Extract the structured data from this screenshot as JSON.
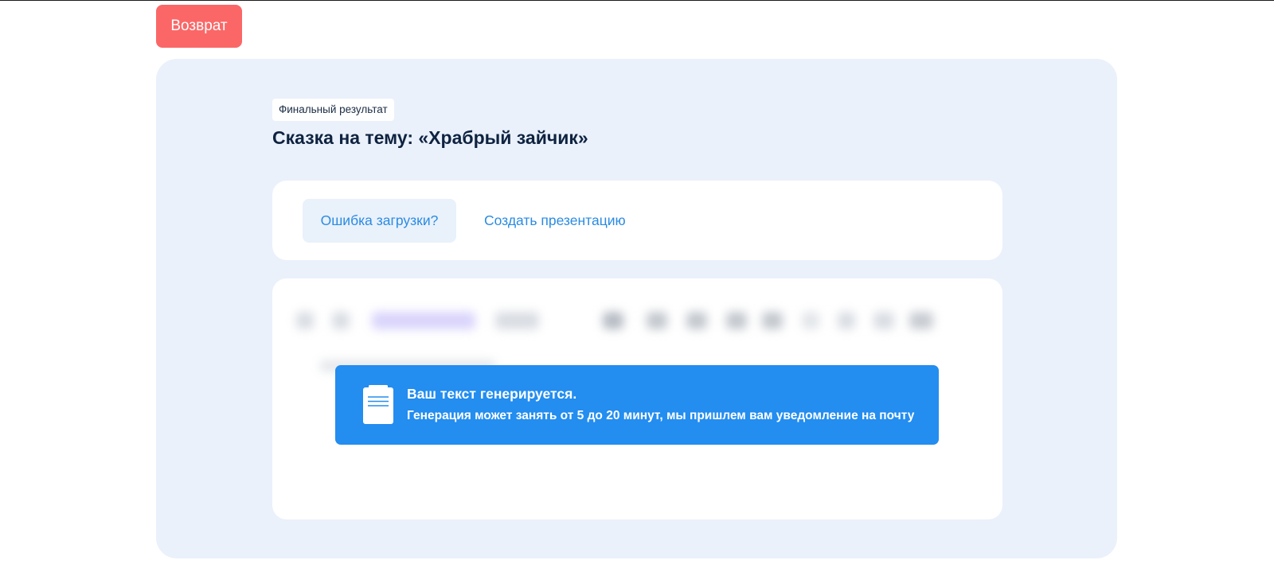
{
  "header": {
    "back_label": "Возврат"
  },
  "result": {
    "badge": "Финальный результат",
    "title": "Сказка на тему: «Храбрый зайчик»"
  },
  "actions": {
    "error_label": "Ошибка загрузки?",
    "presentation_label": "Создать презентацию"
  },
  "notice": {
    "title": "Ваш текст генерируется.",
    "text": "Генерация может занять от 5 до 20 минут, мы пришлем вам уведомление на почту",
    "icon": "document-icon"
  },
  "colors": {
    "back_button": "#fb6767",
    "accent": "#2b8be2",
    "notice_bg": "#238df0",
    "panel_bg": "#eaf1fb",
    "title": "#0f2340"
  }
}
